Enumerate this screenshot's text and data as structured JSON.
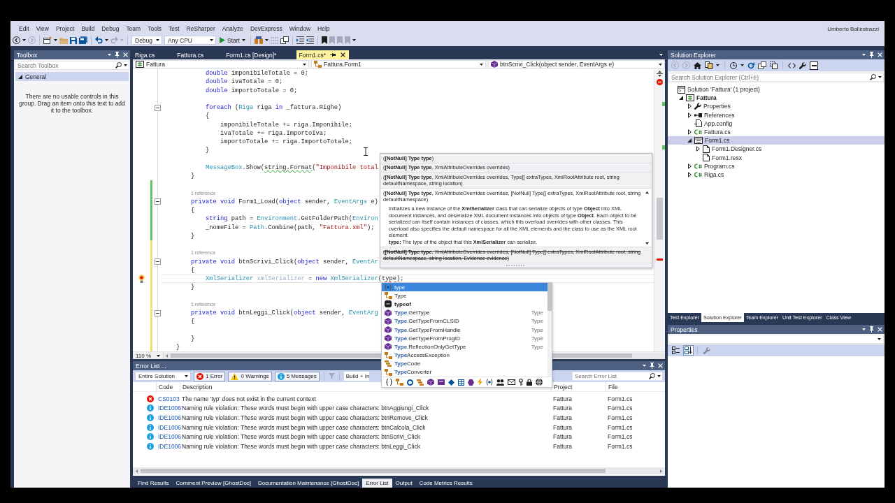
{
  "menu_bar": {
    "items": [
      "Edit",
      "View",
      "Project",
      "Build",
      "Debug",
      "Team",
      "Tools",
      "Test",
      "ReSharper",
      "Analyze",
      "DevExpress",
      "Window",
      "Help"
    ],
    "account": "Umberto Ballestrazzi"
  },
  "toolbar": {
    "configuration": "Debug",
    "platform": "Any CPU",
    "start": "Start"
  },
  "toolbox": {
    "title": "Toolbox",
    "search": {
      "placeholder": "Search Toolbox"
    },
    "group": {
      "label": "General",
      "expanded": true
    },
    "message": "There are no usable controls in this group. Drag an item onto this text to add it to the toolbox."
  },
  "editor": {
    "tabs": [
      {
        "label": "Riga.cs",
        "selected": false
      },
      {
        "label": "Fattura.cs",
        "selected": false
      },
      {
        "label": "Form1.cs [Design]*",
        "selected": false
      },
      {
        "label": "Form1.cs*",
        "selected": true
      }
    ],
    "navigation": {
      "project": "Fattura",
      "type": "Fattura.Form1",
      "member": "btnScrivi_Click(object sender, EventArgs e)"
    },
    "lines": [
      {
        "kind": "block",
        "children": [
          {
            "kind": "block",
            "children": [
              {
                "kind": "block",
                "children": [
                  {
                    "kind": "code",
                    "tokens": [
                      {
                        "kind": "keyword",
                        "text": "double"
                      },
                      {
                        "kind": "plain",
                        "text": " imponibileTotale = 0;"
                      }
                    ],
                    "fold": false,
                    "current": false,
                    "lightbulb": false
                  },
                  {
                    "kind": "code",
                    "tokens": [
                      {
                        "kind": "keyword",
                        "text": "double"
                      },
                      {
                        "kind": "plain",
                        "text": " ivaTotale = 0;"
                      }
                    ],
                    "fold": false,
                    "current": false,
                    "lightbulb": false
                  },
                  {
                    "kind": "code",
                    "tokens": [
                      {
                        "kind": "keyword",
                        "text": "double"
                      },
                      {
                        "kind": "plain",
                        "text": " importoTotale = 0;"
                      }
                    ],
                    "fold": false,
                    "current": false,
                    "lightbulb": false
                  },
                  {
                    "kind": "blank"
                  },
                  {
                    "kind": "code",
                    "tokens": [
                      {
                        "kind": "keyword",
                        "text": "foreach"
                      },
                      {
                        "kind": "plain",
                        "text": " ("
                      },
                      {
                        "kind": "type",
                        "text": "Riga"
                      },
                      {
                        "kind": "plain",
                        "text": " riga "
                      },
                      {
                        "kind": "keyword",
                        "text": "in"
                      },
                      {
                        "kind": "plain",
                        "text": " _fattura.Righe)"
                      }
                    ],
                    "fold": true,
                    "current": false,
                    "lightbulb": false
                  },
                  {
                    "kind": "code",
                    "tokens": [
                      {
                        "kind": "plain",
                        "text": "{"
                      }
                    ],
                    "fold": false,
                    "current": false,
                    "lightbulb": false
                  },
                  {
                    "kind": "block",
                    "children": [
                      {
                        "kind": "code",
                        "tokens": [
                          {
                            "kind": "plain",
                            "text": "imponibileTotale += riga.Imponibile;"
                          }
                        ],
                        "fold": false,
                        "current": false,
                        "lightbulb": false
                      },
                      {
                        "kind": "code",
                        "tokens": [
                          {
                            "kind": "plain",
                            "text": "ivaTotale += riga.ImportoIva;"
                          }
                        ],
                        "fold": false,
                        "current": false,
                        "lightbulb": false
                      },
                      {
                        "kind": "code",
                        "tokens": [
                          {
                            "kind": "plain",
                            "text": "importoTotale += riga.ImportoTotale;"
                          }
                        ],
                        "fold": false,
                        "current": false,
                        "lightbulb": false
                      }
                    ]
                  },
                  {
                    "kind": "code",
                    "tokens": [
                      {
                        "kind": "plain",
                        "text": "}"
                      }
                    ],
                    "fold": false,
                    "current": false,
                    "lightbulb": false
                  },
                  {
                    "kind": "blank"
                  },
                  {
                    "kind": "code",
                    "tokens": [
                      {
                        "kind": "type",
                        "text": "MessageBox"
                      },
                      {
                        "kind": "plain",
                        "text": ".Show("
                      },
                      {
                        "kind": "warning",
                        "text": "string.Format"
                      },
                      {
                        "kind": "plain",
                        "text": "("
                      },
                      {
                        "kind": "string",
                        "text": "\"Imponibile total"
                      }
                    ],
                    "fold": false,
                    "current": false,
                    "lightbulb": false
                  }
                ]
              },
              {
                "kind": "code",
                "tokens": [
                  {
                    "kind": "plain",
                    "text": "}"
                  }
                ],
                "fold": false,
                "current": false,
                "lightbulb": false
              },
              {
                "kind": "blank",
                "color": "#62c462"
              },
              {
                "kind": "lens",
                "text": "1 reference",
                "color": "#62c462",
                "fold": false,
                "current": false,
                "lightbulb": false
              },
              {
                "kind": "code",
                "tokens": [
                  {
                    "kind": "keyword",
                    "text": "private void"
                  },
                  {
                    "kind": "plain",
                    "text": " Form1_Load("
                  },
                  {
                    "kind": "keyword",
                    "text": "object"
                  },
                  {
                    "kind": "plain",
                    "text": " sender, "
                  },
                  {
                    "kind": "type",
                    "text": "EventArgs"
                  },
                  {
                    "kind": "plain",
                    "text": " e)"
                  }
                ],
                "color": "#62c462",
                "fold": true,
                "current": false,
                "lightbulb": false
              },
              {
                "kind": "code",
                "tokens": [
                  {
                    "kind": "plain",
                    "text": "{"
                  }
                ],
                "color": "#62c462",
                "fold": false,
                "current": false,
                "lightbulb": false
              },
              {
                "kind": "block",
                "children": [
                  {
                    "kind": "code",
                    "tokens": [
                      {
                        "kind": "keyword",
                        "text": "string"
                      },
                      {
                        "kind": "plain",
                        "text": " path = "
                      },
                      {
                        "kind": "type",
                        "text": "Environment"
                      },
                      {
                        "kind": "plain",
                        "text": ".GetFolderPath("
                      },
                      {
                        "kind": "type",
                        "text": "Environ"
                      }
                    ],
                    "color": "#62c462",
                    "fold": false,
                    "current": false,
                    "lightbulb": false
                  },
                  {
                    "kind": "code",
                    "tokens": [
                      {
                        "kind": "plain",
                        "text": "_nomeFile = "
                      },
                      {
                        "kind": "type",
                        "text": "Path"
                      },
                      {
                        "kind": "plain",
                        "text": ".Combine(path, "
                      },
                      {
                        "kind": "string",
                        "text": "\"Fattura.xml\""
                      },
                      {
                        "kind": "plain",
                        "text": ");"
                      }
                    ],
                    "color": "#62c462",
                    "fold": false,
                    "current": false,
                    "lightbulb": false
                  }
                ]
              },
              {
                "kind": "code",
                "tokens": [
                  {
                    "kind": "plain",
                    "text": "}"
                  }
                ],
                "color": "#62c462",
                "fold": false,
                "current": false,
                "lightbulb": false
              },
              {
                "kind": "blank",
                "color": "#efe36a"
              },
              {
                "kind": "lens",
                "text": "1 reference",
                "color": "#efe36a",
                "fold": false,
                "current": false,
                "lightbulb": false
              },
              {
                "kind": "code",
                "tokens": [
                  {
                    "kind": "keyword",
                    "text": "private void"
                  },
                  {
                    "kind": "plain",
                    "text": " btnScrivi_Click("
                  },
                  {
                    "kind": "keyword",
                    "text": "object"
                  },
                  {
                    "kind": "plain",
                    "text": " sender, "
                  },
                  {
                    "kind": "type",
                    "text": "EventAr"
                  }
                ],
                "color": "#efe36a",
                "fold": true,
                "current": false,
                "lightbulb": false
              },
              {
                "kind": "code",
                "tokens": [
                  {
                    "kind": "plain",
                    "text": "{"
                  }
                ],
                "color": "#efe36a",
                "fold": false,
                "current": false,
                "lightbulb": false
              },
              {
                "kind": "block",
                "children": [
                  {
                    "kind": "code",
                    "tokens": [
                      {
                        "kind": "type",
                        "text": "XmlSerializer"
                      },
                      {
                        "kind": "unused",
                        "text": " xmlSerializer"
                      },
                      {
                        "kind": "plain",
                        "text": " = "
                      },
                      {
                        "kind": "keyword",
                        "text": "new"
                      },
                      {
                        "kind": "type",
                        "text": " XmlSerializer"
                      },
                      {
                        "kind": "plain",
                        "text": "("
                      },
                      {
                        "kind": "error",
                        "text": "type"
                      },
                      {
                        "kind": "plain",
                        "text": ");"
                      }
                    ],
                    "color": "#efe36a",
                    "fold": false,
                    "current": true,
                    "lightbulb": true
                  }
                ]
              },
              {
                "kind": "code",
                "tokens": [
                  {
                    "kind": "plain",
                    "text": "}"
                  }
                ],
                "color": "#efe36a",
                "fold": false,
                "current": false,
                "lightbulb": false
              },
              {
                "kind": "blank",
                "color": "#efe36a"
              },
              {
                "kind": "lens",
                "text": "1 reference",
                "color": "#efe36a",
                "fold": false,
                "current": false,
                "lightbulb": false
              },
              {
                "kind": "code",
                "tokens": [
                  {
                    "kind": "keyword",
                    "text": "private void"
                  },
                  {
                    "kind": "plain",
                    "text": " btnLeggi_Click("
                  },
                  {
                    "kind": "keyword",
                    "text": "object"
                  },
                  {
                    "kind": "plain",
                    "text": " sender, "
                  },
                  {
                    "kind": "type",
                    "text": "EventArg"
                  }
                ],
                "color": "#efe36a",
                "fold": true,
                "current": false,
                "lightbulb": false
              },
              {
                "kind": "code",
                "tokens": [
                  {
                    "kind": "plain",
                    "text": "{"
                  }
                ],
                "color": "#efe36a",
                "fold": false,
                "current": false,
                "lightbulb": false
              },
              {
                "kind": "blank",
                "color": "#efe36a"
              },
              {
                "kind": "code",
                "tokens": [
                  {
                    "kind": "plain",
                    "text": "}"
                  }
                ],
                "color": "#efe36a",
                "fold": false,
                "current": false,
                "lightbulb": false
              }
            ]
          },
          {
            "kind": "code",
            "tokens": [
              {
                "kind": "plain",
                "text": "}"
              }
            ],
            "color": "#efe36a",
            "fold": false,
            "current": false,
            "lightbulb": false
          }
        ]
      }
    ],
    "zoom": "110 %"
  },
  "signature_help": {
    "overloads": [
      {
        "signature": "(**[NotNull] Type type**)",
        "selected": false,
        "obsolete": false
      },
      {
        "signature": "(**[NotNull] Type type**, XmlAttributeOverrides overrides)",
        "selected": false,
        "obsolete": false
      },
      {
        "signature": "(**[NotNull] Type type**, XmlAttributeOverrides overrides, Type[] extraTypes, XmlRootAttribute root, string defaultNamespace, string location)",
        "selected": false,
        "obsolete": false
      },
      {
        "signature": "(**[NotNull] Type type**, XmlAttributeOverrides overrides, [NotNull] Type[] extraTypes, XmlRootAttribute root, string defaultNamespace)",
        "selected": true,
        "obsolete": false,
        "description": "Initializes a new instance of the **XmlSerializer** class that can serialize objects of type **Object** into XML document instances, and deserialize XML document instances into objects of type **Object**. Each object to be serialized can itself contain instances of classes, which this overload overrides with other classes. This overload also specifies the default namespace for all the XML elements and the class to use as the XML root element.",
        "parameter": "**type:** The type of the object that this **XmlSerializer** can serialize."
      },
      {
        "signature": "(**[NotNull] Type type**, XmlAttributeOverrides overrides, [NotNull] Type[] extraTypes, XmlRootAttribute root, string defaultNamespace, string location, Evidence evidence)",
        "selected": false,
        "obsolete": true
      }
    ]
  },
  "completion": {
    "items": [
      {
        "kind": "local",
        "label": "type",
        "selected": true
      },
      {
        "kind": "class",
        "label": "Type",
        "selected": false
      },
      {
        "kind": "keyword",
        "label": "typeof",
        "selected": false
      },
      {
        "kind": "method",
        "label": "**Type**.GetType",
        "detail": "Type",
        "selected": false
      },
      {
        "kind": "method",
        "label": "**Type**.GetTypeFromCLSID",
        "detail": "Type",
        "selected": false
      },
      {
        "kind": "method",
        "label": "**Type**.GetTypeFromHandle",
        "detail": "Type",
        "selected": false
      },
      {
        "kind": "method",
        "label": "**Type**.GetTypeFromProgID",
        "detail": "Type",
        "selected": false
      },
      {
        "kind": "method",
        "label": "**Type**.ReflectionOnlyGetType",
        "detail": "Type",
        "selected": false
      },
      {
        "kind": "class",
        "label": "**Type**AccessException",
        "selected": false
      },
      {
        "kind": "enum",
        "label": "**Type**Code",
        "selected": false
      },
      {
        "kind": "class",
        "label": "**Type**Converter",
        "selected": false
      }
    ]
  },
  "error_list": {
    "title": "Error List ...",
    "scope": "Entire Solution",
    "filters": [
      {
        "kind": "error",
        "label": "1 Error",
        "selected": true
      },
      {
        "kind": "warning",
        "label": "0 Warnings",
        "selected": true
      },
      {
        "kind": "message",
        "label": "5 Messages",
        "selected": true
      }
    ],
    "source": "Build + In",
    "search": {
      "placeholder": "Search Error List"
    },
    "columns": [
      "Code",
      "Description",
      "Project",
      "File"
    ],
    "rows": [
      {
        "kind": "error",
        "code": "CS0103",
        "description": "The name 'typ' does not exist in the current context",
        "project": "Fattura",
        "file": "Form1.cs"
      },
      {
        "kind": "info",
        "code": "IDE1006",
        "description": "Naming rule violation: These words must begin with upper case characters: btnAggiungi_Click",
        "project": "Fattura",
        "file": "Form1.cs"
      },
      {
        "kind": "info",
        "code": "IDE1006",
        "description": "Naming rule violation: These words must begin with upper case characters: btnRemove_Click",
        "project": "Fattura",
        "file": "Form1.cs"
      },
      {
        "kind": "info",
        "code": "IDE1006",
        "description": "Naming rule violation: These words must begin with upper case characters: btnCalcola_Click",
        "project": "Fattura",
        "file": "Form1.cs"
      },
      {
        "kind": "info",
        "code": "IDE1006",
        "description": "Naming rule violation: These words must begin with upper case characters: btnScrivi_Click",
        "project": "Fattura",
        "file": "Form1.cs"
      },
      {
        "kind": "info",
        "code": "IDE1006",
        "description": "Naming rule violation: These words must begin with upper case characters: btnLeggi_Click",
        "project": "Fattura",
        "file": "Form1.cs"
      }
    ]
  },
  "bottom_tabs": [
    {
      "label": "Find Results",
      "selected": false
    },
    {
      "label": "Comment Preview [GhostDoc]",
      "selected": false
    },
    {
      "label": "Documentation Maintenance [GhostDoc]",
      "selected": false
    },
    {
      "label": "Error List",
      "selected": true
    },
    {
      "label": "Output",
      "selected": false
    },
    {
      "label": "Code Metrics Results",
      "selected": false
    }
  ],
  "solution_explorer": {
    "title": "Solution Explorer",
    "search": {
      "placeholder": "Search Solution Explorer (Ctrl+è)"
    },
    "items": [
      {
        "label": "Solution 'Fattura' (1 project)",
        "kind": "solution",
        "selected": false,
        "children": [
          {
            "label": "Fattura",
            "kind": "project",
            "expanded": true,
            "selected": false,
            "children": [
              {
                "label": "Properties",
                "kind": "properties",
                "expanded": false,
                "selected": false
              },
              {
                "label": "References",
                "kind": "references",
                "expanded": false,
                "selected": false
              },
              {
                "label": "App.config",
                "kind": "config",
                "selected": false
              },
              {
                "label": "Fattura.cs",
                "kind": "csharp",
                "expanded": false,
                "selected": false
              },
              {
                "label": "Form1.cs",
                "kind": "form",
                "expanded": true,
                "selected": true,
                "children": [
                  {
                    "label": "Form1.Designer.cs",
                    "kind": "document",
                    "expanded": false,
                    "selected": false
                  },
                  {
                    "label": "Form1.resx",
                    "kind": "document",
                    "selected": false
                  }
                ]
              },
              {
                "label": "Program.cs",
                "kind": "csharp",
                "expanded": false,
                "selected": false
              },
              {
                "label": "Riga.cs",
                "kind": "csharp",
                "expanded": false,
                "selected": false
              }
            ]
          }
        ]
      }
    ],
    "tabs": [
      {
        "label": "Test Explorer",
        "selected": false
      },
      {
        "label": "Solution Explorer",
        "selected": true
      },
      {
        "label": "Team Explorer",
        "selected": false
      },
      {
        "label": "Unit Test Explorer",
        "selected": false
      },
      {
        "label": "Class View",
        "selected": false
      }
    ]
  },
  "properties": {
    "title": "Properties",
    "toolbar": [
      {
        "kind": "categorized",
        "selected": false,
        "disabled": false
      },
      {
        "kind": "alphabetical",
        "selected": true,
        "disabled": false
      },
      {
        "kind": "pages",
        "selected": false,
        "disabled": true
      }
    ]
  }
}
